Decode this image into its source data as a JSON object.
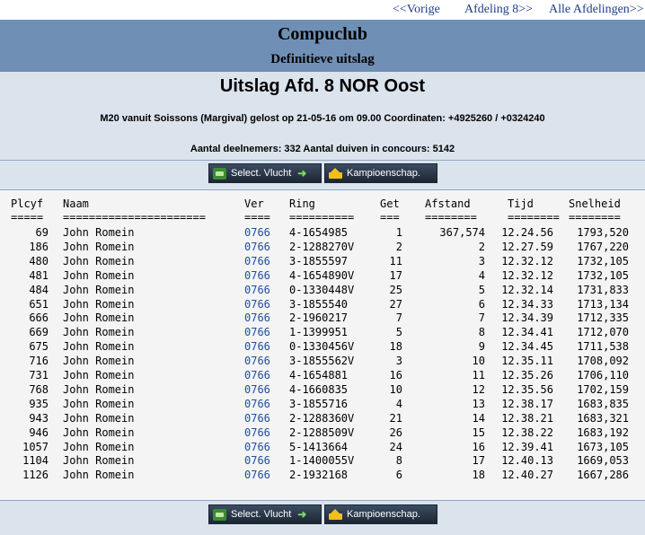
{
  "nav": {
    "prev": "<<Vorige",
    "afdeling": "Afdeling 8>>",
    "alle": "Alle Afdelingen>>"
  },
  "club": {
    "name": "Compuclub",
    "subtitle": "Definitieve uitslag"
  },
  "header": {
    "title": "Uitslag Afd. 8 NOR Oost",
    "line1": "M20 vanuit Soissons (Margival) gelost op 21-05-16 om 09.00 Coordinaten: +4925260 / +0324240",
    "line2": "Aantal deelnemers: 332 Aantal duiven in concours: 5142"
  },
  "buttons": {
    "vlucht": "Select. Vlucht",
    "kampioen": "Kampioenschap."
  },
  "colors": {
    "band": "#6f8fb5",
    "background": "#dbe3ec",
    "table_bg": "#f4f4f4",
    "link": "#1f4e9b"
  },
  "table": {
    "headers": [
      "Plcyf",
      "Naam",
      "Ver",
      "Ring",
      "Get",
      "Afstand",
      "Tijd",
      "Snelheid"
    ],
    "underlines": [
      "=====",
      "======================",
      "====",
      "==========",
      "===",
      "========",
      "========",
      "========"
    ],
    "rows": [
      [
        "69",
        "John Romein",
        "0766",
        "4-1654985",
        "1",
        "367,574",
        "12.24.56",
        "1793,520"
      ],
      [
        "186",
        "John Romein",
        "0766",
        "2-1288270V",
        "2",
        "2",
        "12.27.59",
        "1767,220"
      ],
      [
        "480",
        "John Romein",
        "0766",
        "3-1855597",
        "11",
        "3",
        "12.32.12",
        "1732,105"
      ],
      [
        "481",
        "John Romein",
        "0766",
        "4-1654890V",
        "17",
        "4",
        "12.32.12",
        "1732,105"
      ],
      [
        "484",
        "John Romein",
        "0766",
        "0-1330448V",
        "25",
        "5",
        "12.32.14",
        "1731,833"
      ],
      [
        "651",
        "John Romein",
        "0766",
        "3-1855540",
        "27",
        "6",
        "12.34.33",
        "1713,134"
      ],
      [
        "666",
        "John Romein",
        "0766",
        "2-1960217",
        "7",
        "7",
        "12.34.39",
        "1712,335"
      ],
      [
        "669",
        "John Romein",
        "0766",
        "1-1399951",
        "5",
        "8",
        "12.34.41",
        "1712,070"
      ],
      [
        "675",
        "John Romein",
        "0766",
        "0-1330456V",
        "18",
        "9",
        "12.34.45",
        "1711,538"
      ],
      [
        "716",
        "John Romein",
        "0766",
        "3-1855562V",
        "3",
        "10",
        "12.35.11",
        "1708,092"
      ],
      [
        "731",
        "John Romein",
        "0766",
        "4-1654881",
        "16",
        "11",
        "12.35.26",
        "1706,110"
      ],
      [
        "768",
        "John Romein",
        "0766",
        "4-1660835",
        "10",
        "12",
        "12.35.56",
        "1702,159"
      ],
      [
        "935",
        "John Romein",
        "0766",
        "3-1855716",
        "4",
        "13",
        "12.38.17",
        "1683,835"
      ],
      [
        "943",
        "John Romein",
        "0766",
        "2-1288360V",
        "21",
        "14",
        "12.38.21",
        "1683,321"
      ],
      [
        "946",
        "John Romein",
        "0766",
        "2-1288509V",
        "26",
        "15",
        "12.38.22",
        "1683,192"
      ],
      [
        "1057",
        "John Romein",
        "0766",
        "5-1413664",
        "24",
        "16",
        "12.39.41",
        "1673,105"
      ],
      [
        "1104",
        "John Romein",
        "0766",
        "1-1400055V",
        "8",
        "17",
        "12.40.13",
        "1669,053"
      ],
      [
        "1126",
        "John Romein",
        "0766",
        "2-1932168",
        "6",
        "18",
        "12.40.27",
        "1667,286"
      ]
    ]
  }
}
